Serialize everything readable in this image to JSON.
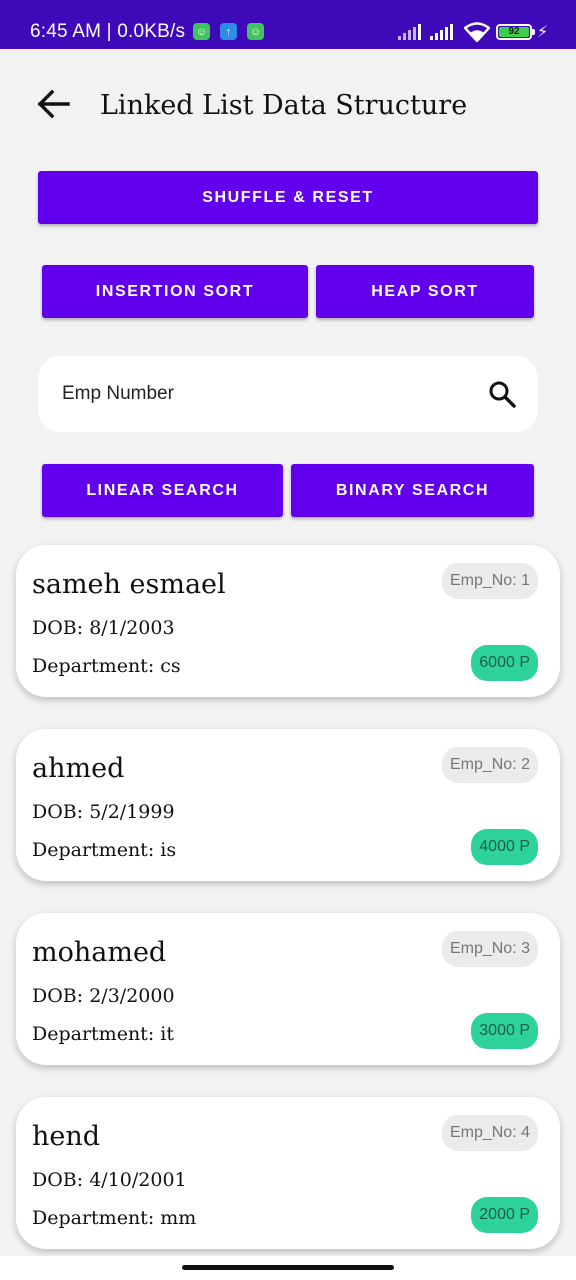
{
  "status_bar": {
    "time": "6:45 AM | 0.0KB/s",
    "battery": "92",
    "notification_icons": [
      "app-icon-green",
      "upload-icon-blue",
      "app-icon-green"
    ]
  },
  "header": {
    "title": "Linked List Data Structure",
    "back_icon": "back-arrow-icon"
  },
  "buttons": {
    "shuffle_reset": "SHUFFLE & RESET",
    "insertion_sort": "INSERTION SORT",
    "heap_sort": "HEAP SORT",
    "linear_search": "LINEAR SEARCH",
    "binary_search": "BINARY SEARCH"
  },
  "search": {
    "placeholder": "Emp Number",
    "icon": "search-icon"
  },
  "employees": [
    {
      "name": "sameh esmael",
      "dob": "DOB: 8/1/2003",
      "department": "Department: cs",
      "emp_no": "Emp_No: 1",
      "salary": "6000 P"
    },
    {
      "name": "ahmed",
      "dob": "DOB: 5/2/1999",
      "department": "Department: is",
      "emp_no": "Emp_No: 2",
      "salary": "4000 P"
    },
    {
      "name": "mohamed",
      "dob": "DOB: 2/3/2000",
      "department": "Department: it",
      "emp_no": "Emp_No: 3",
      "salary": "3000 P"
    },
    {
      "name": "hend",
      "dob": "DOB: 4/10/2001",
      "department": "Department: mm",
      "emp_no": "Emp_No: 4",
      "salary": "2000 P"
    }
  ],
  "colors": {
    "status_bar": "#3d09b9",
    "accent": "#6200ee",
    "salary_badge": "#2ed39b",
    "background": "#f2f2f2"
  }
}
